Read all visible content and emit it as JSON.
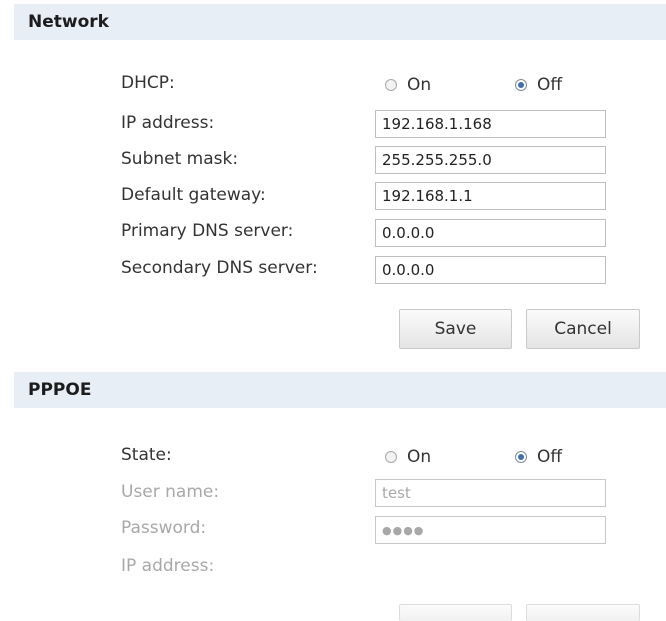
{
  "network": {
    "title": "Network",
    "dhcp": {
      "label": "DHCP:",
      "on_label": "On",
      "off_label": "Off",
      "selected": "Off"
    },
    "fields": [
      {
        "label": "IP address:",
        "value": "192.168.1.168"
      },
      {
        "label": "Subnet mask:",
        "value": "255.255.255.0"
      },
      {
        "label": "Default gateway:",
        "value": "192.168.1.1"
      },
      {
        "label": "Primary DNS server:",
        "value": "0.0.0.0"
      },
      {
        "label": "Secondary DNS server:",
        "value": "0.0.0.0"
      }
    ],
    "save_label": "Save",
    "cancel_label": "Cancel"
  },
  "pppoe": {
    "title": "PPPOE",
    "state": {
      "label": "State:",
      "on_label": "On",
      "off_label": "Off",
      "selected": "Off"
    },
    "username": {
      "label": "User name:",
      "value": "test"
    },
    "password": {
      "label": "Password:",
      "value": "●●●●"
    },
    "ip_address": {
      "label": "IP address:"
    }
  },
  "colors": {
    "header_bg": "#e8eef6",
    "disabled_text": "#a8a8a8",
    "radio_dot": "#3d6fb2"
  }
}
